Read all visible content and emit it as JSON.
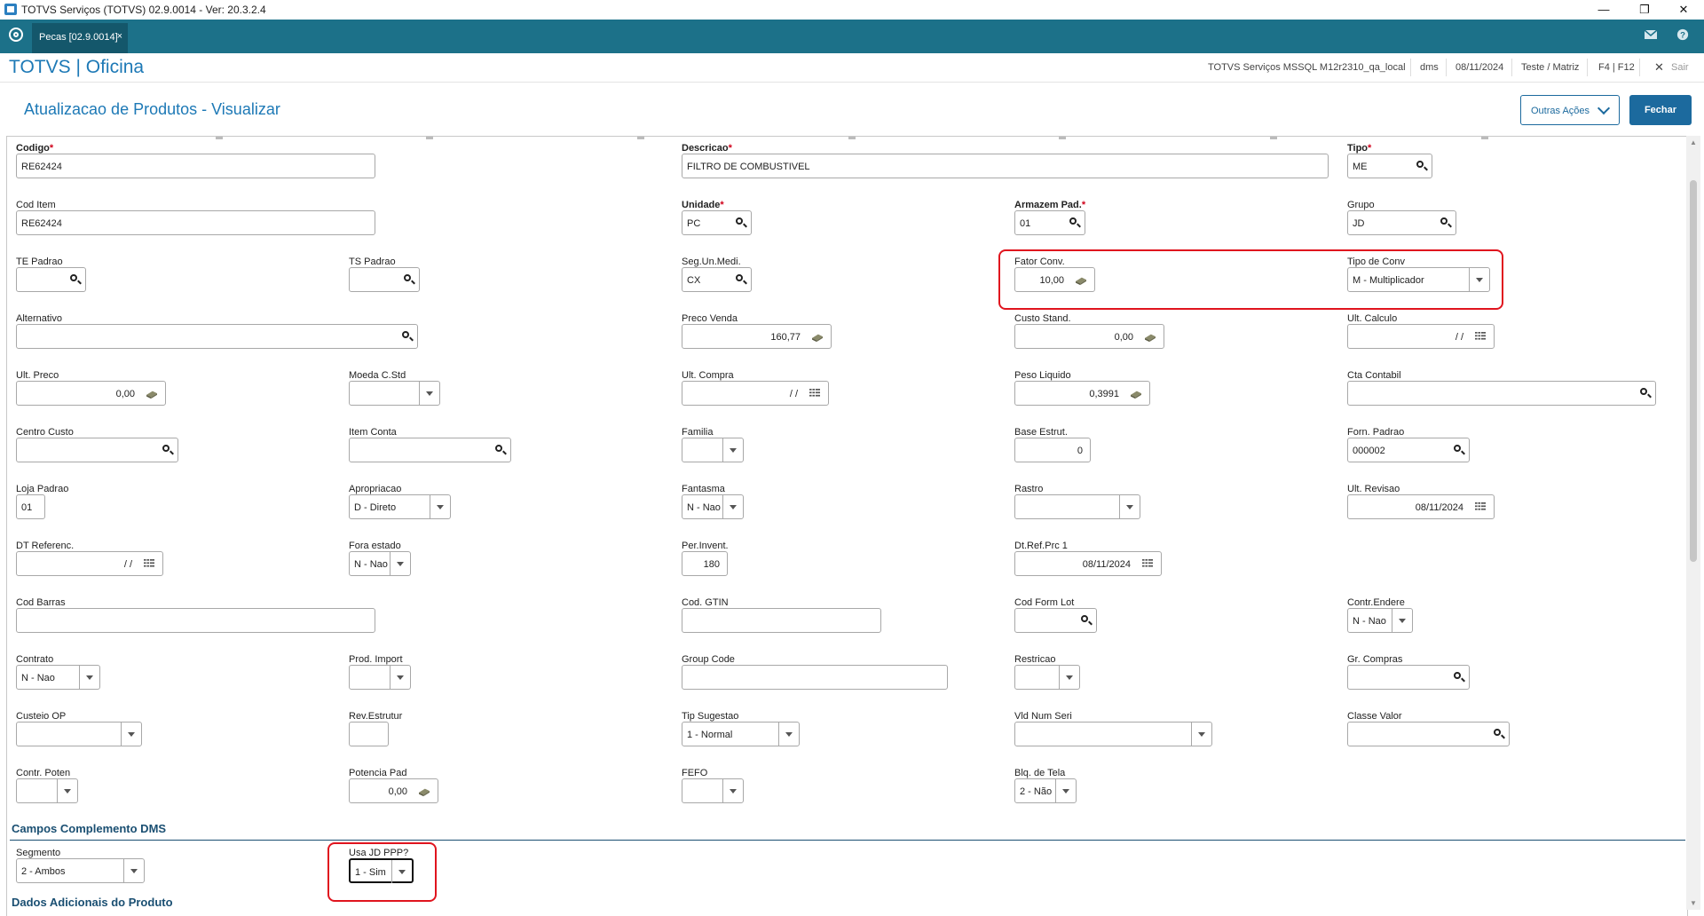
{
  "window": {
    "title": "TOTVS Serviços (TOTVS) 02.9.0014 - Ver: 20.3.2.4",
    "controls": {
      "minimize": "—",
      "maximize": "❐",
      "close": "✕"
    }
  },
  "tabbar": {
    "tab_label": "Pecas [02.9.0014]",
    "tab_close": "×"
  },
  "header": {
    "brand": "TOTVS | Oficina",
    "environment": "TOTVS Serviços MSSQL M12r2310_qa_local",
    "user": "dms",
    "date": "08/11/2024",
    "branch": "Teste / Matriz",
    "shortcuts": "F4 | F12",
    "exit_label": "Sair",
    "exit_icon": "✕"
  },
  "page": {
    "title": "Atualizacao de Produtos - Visualizar",
    "other_actions": "Outras Ações",
    "close": "Fechar"
  },
  "fields": {
    "codigo": {
      "label": "Codigo",
      "value": "RE62424"
    },
    "descricao": {
      "label": "Descricao",
      "value": "FILTRO DE COMBUSTIVEL"
    },
    "tipo": {
      "label": "Tipo",
      "value": "ME"
    },
    "cod_item": {
      "label": "Cod Item",
      "value": "RE62424"
    },
    "unidade": {
      "label": "Unidade",
      "value": "PC"
    },
    "armazem_pad": {
      "label": "Armazem Pad.",
      "value": "01"
    },
    "grupo": {
      "label": "Grupo",
      "value": "JD"
    },
    "te_padrao": {
      "label": "TE Padrao",
      "value": ""
    },
    "ts_padrao": {
      "label": "TS Padrao",
      "value": ""
    },
    "seg_un_medi": {
      "label": "Seg.Un.Medi.",
      "value": "CX"
    },
    "fator_conv": {
      "label": "Fator Conv.",
      "value": "10,00"
    },
    "tipo_de_conv": {
      "label": "Tipo de Conv",
      "value": "M - Multiplicador"
    },
    "alternativo": {
      "label": "Alternativo",
      "value": ""
    },
    "preco_venda": {
      "label": "Preco Venda",
      "value": "160,77"
    },
    "custo_stand": {
      "label": "Custo Stand.",
      "value": "0,00"
    },
    "ult_calculo": {
      "label": "Ult. Calculo",
      "value": "/ /"
    },
    "ult_preco": {
      "label": "Ult. Preco",
      "value": "0,00"
    },
    "moeda_cstd": {
      "label": "Moeda C.Std",
      "value": ""
    },
    "ult_compra": {
      "label": "Ult. Compra",
      "value": "/ /"
    },
    "peso_liquido": {
      "label": "Peso Liquido",
      "value": "0,3991"
    },
    "cta_contabil": {
      "label": "Cta Contabil",
      "value": ""
    },
    "centro_custo": {
      "label": "Centro Custo",
      "value": ""
    },
    "item_conta": {
      "label": "Item Conta",
      "value": ""
    },
    "familia": {
      "label": "Familia",
      "value": ""
    },
    "base_estrut": {
      "label": "Base Estrut.",
      "value": "0"
    },
    "forn_padrao": {
      "label": "Forn. Padrao",
      "value": "000002"
    },
    "loja_padrao": {
      "label": "Loja Padrao",
      "value": "01"
    },
    "apropriacao": {
      "label": "Apropriacao",
      "value": "D - Direto"
    },
    "fantasma": {
      "label": "Fantasma",
      "value": "N - Nao"
    },
    "rastro": {
      "label": "Rastro",
      "value": ""
    },
    "ult_revisao": {
      "label": "Ult. Revisao",
      "value": "08/11/2024"
    },
    "dt_referenc": {
      "label": "DT Referenc.",
      "value": "/ /"
    },
    "fora_estado": {
      "label": "Fora estado",
      "value": "N - Nao"
    },
    "per_invent": {
      "label": "Per.Invent.",
      "value": "180"
    },
    "dt_ref_prc1": {
      "label": "Dt.Ref.Prc 1",
      "value": "08/11/2024"
    },
    "cod_barras": {
      "label": "Cod Barras",
      "value": ""
    },
    "cod_gtin": {
      "label": "Cod. GTIN",
      "value": ""
    },
    "cod_form_lot": {
      "label": "Cod Form Lot",
      "value": ""
    },
    "contr_endere": {
      "label": "Contr.Endere",
      "value": "N - Nao"
    },
    "contrato": {
      "label": "Contrato",
      "value": "N - Nao"
    },
    "prod_import": {
      "label": "Prod. Import",
      "value": ""
    },
    "group_code": {
      "label": "Group Code",
      "value": ""
    },
    "restricao": {
      "label": "Restricao",
      "value": ""
    },
    "gr_compras": {
      "label": "Gr. Compras",
      "value": ""
    },
    "custeio_op": {
      "label": "Custeio OP",
      "value": ""
    },
    "rev_estrutur": {
      "label": "Rev.Estrutur",
      "value": ""
    },
    "tip_sugestao": {
      "label": "Tip Sugestao",
      "value": "1 - Normal"
    },
    "vld_num_seri": {
      "label": "Vld Num Seri",
      "value": ""
    },
    "classe_valor": {
      "label": "Classe Valor",
      "value": ""
    },
    "contr_poten": {
      "label": "Contr. Poten",
      "value": ""
    },
    "potencia_pad": {
      "label": "Potencia Pad",
      "value": "0,00"
    },
    "fefo": {
      "label": "FEFO",
      "value": ""
    },
    "blq_de_tela": {
      "label": "Blq. de Tela",
      "value": "2 - Não"
    },
    "segmento": {
      "label": "Segmento",
      "value": "2 - Ambos"
    },
    "usa_jd_ppp": {
      "label": "Usa JD PPP?",
      "value": "1 - Sim"
    }
  },
  "sections": {
    "dms": "Campos Complemento DMS",
    "adicionais": "Dados Adicionais do Produto"
  },
  "icons": {
    "search": "search-icon",
    "calculator": "calculator-icon",
    "calendar": "calendar-icon",
    "dropdown": "chevron-down-icon"
  },
  "colors": {
    "tabbar": "#1c7189",
    "brand": "#1d79b6",
    "button": "#1c6a9e",
    "highlight": "#e0141e",
    "required": "#d0021b"
  }
}
